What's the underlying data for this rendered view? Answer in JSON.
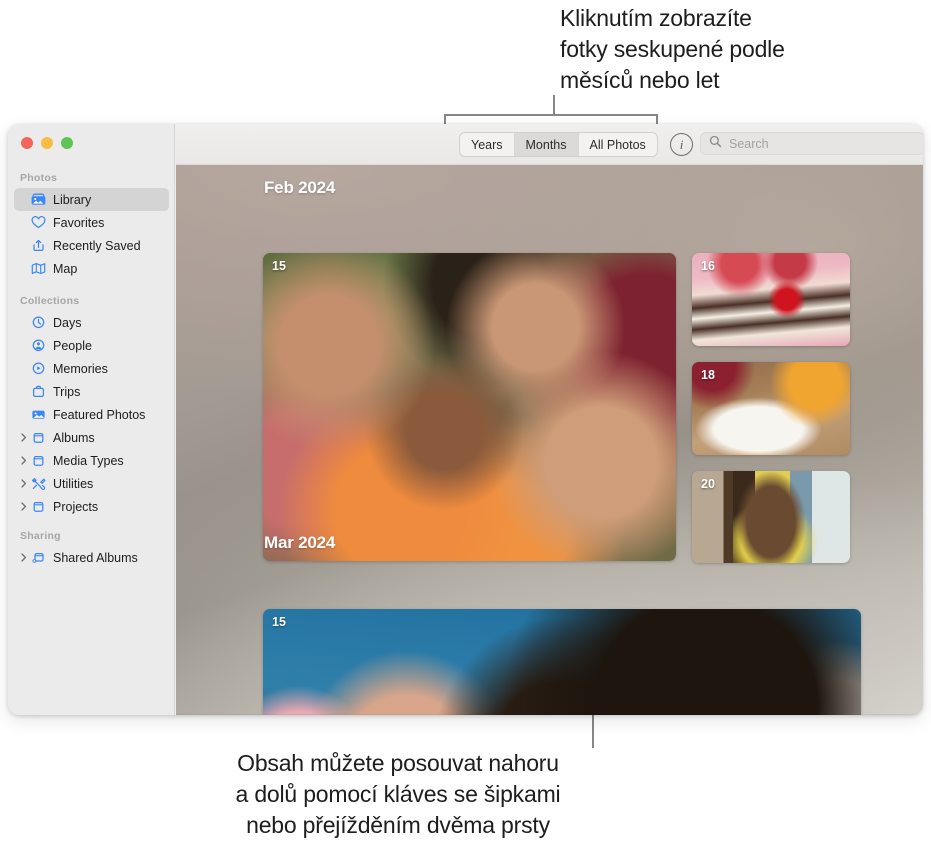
{
  "callouts": {
    "top": "Kliknutím zobrazíte\nfotky seskupené podle\nměsíců nebo let",
    "bottom": "Obsah můžete posouvat nahoru\na dolů pomocí kláves se šipkami\nnebo přejížděním dvěma prsty"
  },
  "window": {
    "traffic_lights": {
      "close": "close-button",
      "minimize": "minimize-button",
      "zoom": "zoom-button"
    }
  },
  "sidebar": {
    "groups": [
      {
        "title": "Photos",
        "items": [
          {
            "label": "Library",
            "icon": "library-icon",
            "selected": true,
            "chevron": false
          },
          {
            "label": "Favorites",
            "icon": "heart-icon",
            "selected": false,
            "chevron": false
          },
          {
            "label": "Recently Saved",
            "icon": "recently-saved-icon",
            "selected": false,
            "chevron": false
          },
          {
            "label": "Map",
            "icon": "map-icon",
            "selected": false,
            "chevron": false
          }
        ]
      },
      {
        "title": "Collections",
        "items": [
          {
            "label": "Days",
            "icon": "clock-icon",
            "selected": false,
            "chevron": false
          },
          {
            "label": "People",
            "icon": "person-icon",
            "selected": false,
            "chevron": false
          },
          {
            "label": "Memories",
            "icon": "memories-icon",
            "selected": false,
            "chevron": false
          },
          {
            "label": "Trips",
            "icon": "trips-icon",
            "selected": false,
            "chevron": false
          },
          {
            "label": "Featured Photos",
            "icon": "featured-photos-icon",
            "selected": false,
            "chevron": false
          },
          {
            "label": "Albums",
            "icon": "album-icon",
            "selected": false,
            "chevron": true
          },
          {
            "label": "Media Types",
            "icon": "album-icon",
            "selected": false,
            "chevron": true
          },
          {
            "label": "Utilities",
            "icon": "utilities-icon",
            "selected": false,
            "chevron": true
          },
          {
            "label": "Projects",
            "icon": "album-icon",
            "selected": false,
            "chevron": true
          }
        ]
      },
      {
        "title": "Sharing",
        "items": [
          {
            "label": "Shared Albums",
            "icon": "shared-album-icon",
            "selected": false,
            "chevron": true
          }
        ]
      }
    ]
  },
  "toolbar": {
    "segmented": {
      "options": [
        "Years",
        "Months",
        "All Photos"
      ],
      "selected": "Months"
    },
    "info_button": "i",
    "search": {
      "value": "",
      "placeholder": "Search"
    }
  },
  "content": {
    "sections": [
      {
        "header": "Feb 2024",
        "tiles": [
          {
            "day": "15",
            "name": "photo-group-selfie"
          },
          {
            "day": "16",
            "name": "photo-cake-slice"
          },
          {
            "day": "18",
            "name": "photo-plated-food"
          },
          {
            "day": "20",
            "name": "photo-portrait-beach"
          }
        ]
      },
      {
        "header": "Mar 2024",
        "tiles": [
          {
            "day": "15",
            "name": "photo-portrait-blue"
          }
        ]
      }
    ]
  }
}
